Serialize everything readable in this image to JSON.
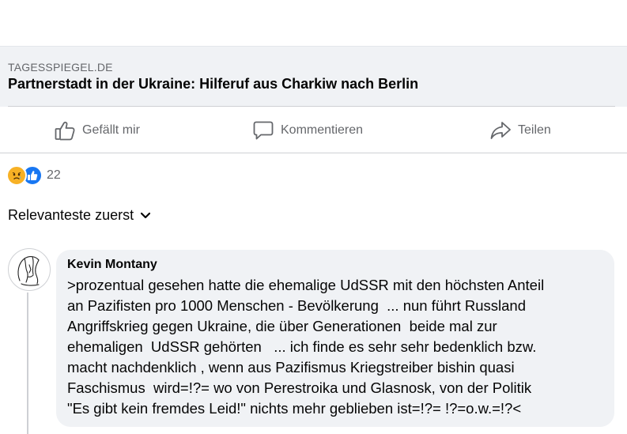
{
  "link_preview": {
    "domain": "TAGESSPIEGEL.DE",
    "title": "Partnerstadt in der Ukraine: Hilferuf aus Charkiw nach Berlin"
  },
  "actions": {
    "like_label": "Gefällt mir",
    "comment_label": "Kommentieren",
    "share_label": "Teilen"
  },
  "reactions": {
    "icons": [
      "sad-reaction-icon",
      "like-reaction-icon"
    ],
    "count": "22",
    "colors": {
      "sad": "#f7b125",
      "like": "#1877f2"
    }
  },
  "sort": {
    "label": "Relevanteste zuerst"
  },
  "comment": {
    "author": "Kevin Montany",
    "lines": [
      ">prozentual gesehen hatte die ehemalige UdSSR mit den höchsten Anteil",
      "an Pazifisten pro 1000 Menschen - Bevölkerung  ... nun führt Russland",
      "Angriffskrieg gegen Ukraine, die über Generationen  beide mal zur",
      "ehemaligen  UdSSR gehörten   ... ich finde es sehr sehr bedenklich bzw.",
      "macht nachdenklich , wenn aus Pazifismus Kriegstreiber bishin quasi",
      "Faschismus  wird=!?= wo von Perestroika und Glasnosk, von der Politik",
      "\"Es gibt kein fremdes Leid!\" nichts mehr geblieben ist=!?= !?=o.w.=!?<"
    ]
  }
}
